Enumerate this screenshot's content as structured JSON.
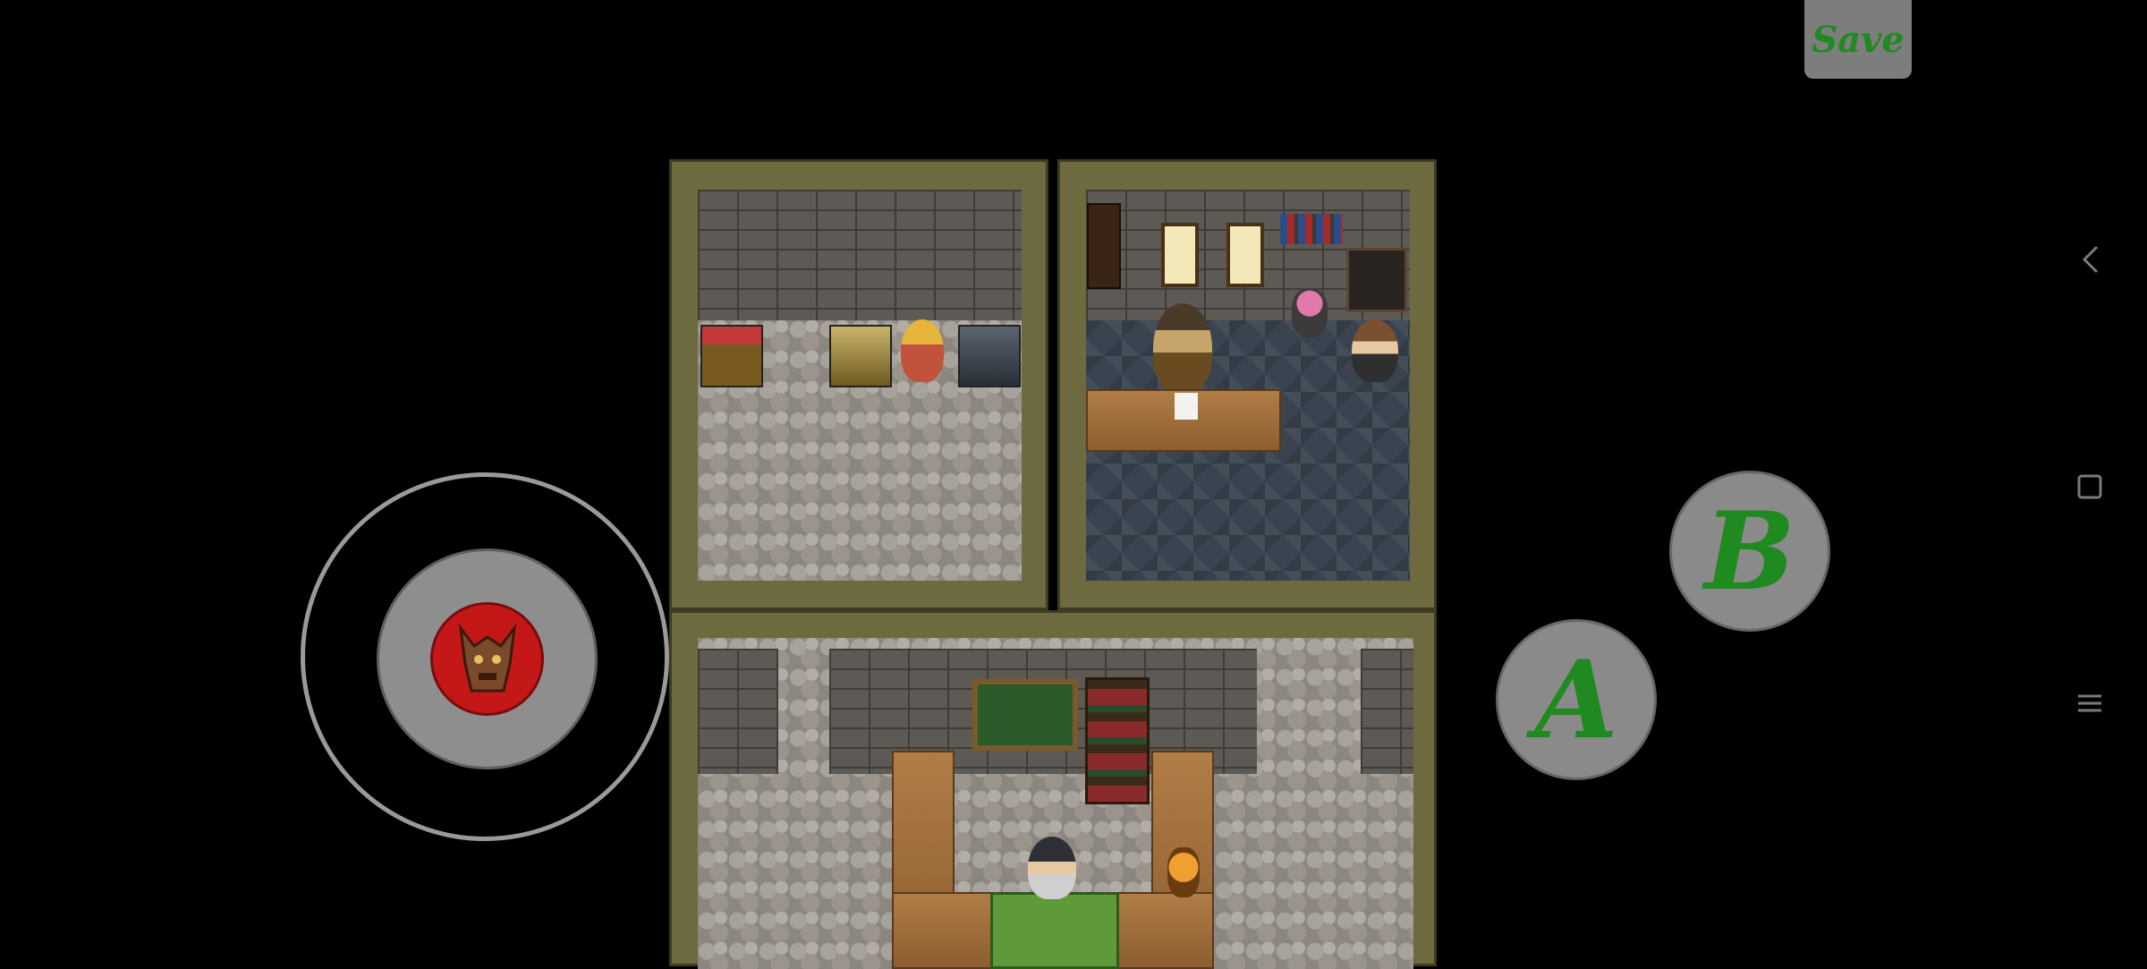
{
  "controls": {
    "save_label": "Save",
    "a_label": "A",
    "b_label": "B"
  },
  "system_nav": {
    "back_icon": "chevron-left-icon",
    "home_icon": "square-icon",
    "menu_icon": "hamburger-icon"
  },
  "colors": {
    "button_text": "#1f8a1f",
    "joystick_knob": "#c41818",
    "button_bg": "#8a8a8a",
    "wall_trim": "#6e6a3f"
  }
}
